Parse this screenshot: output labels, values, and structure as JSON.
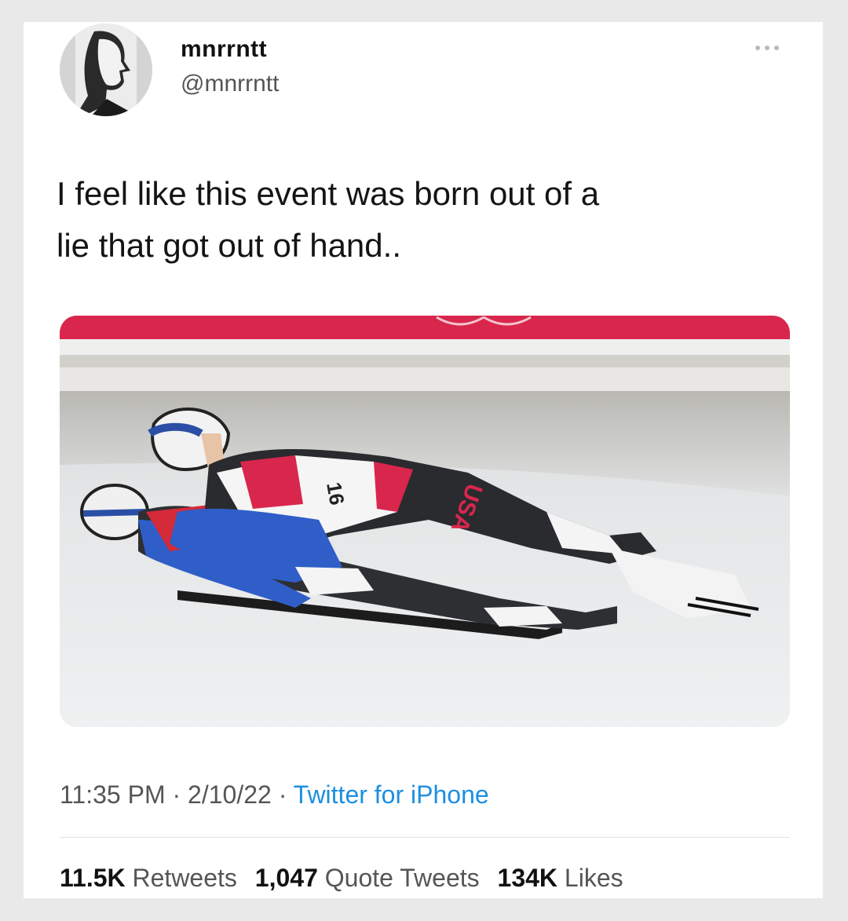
{
  "user": {
    "display_name": "mnrrntt",
    "handle": "@mnrrntt"
  },
  "tweet": {
    "text_line1": "I feel like this event was born out of a",
    "text_line2": "lie that got out of hand.."
  },
  "media": {
    "bib_number": "16",
    "suit_text": "USA"
  },
  "meta": {
    "time": "11:35 PM",
    "separator": "·",
    "date": "2/10/22",
    "source": "Twitter for iPhone"
  },
  "stats": {
    "retweets_count": "11.5K",
    "retweets_label": "Retweets",
    "quotes_count": "1,047",
    "quotes_label": "Quote Tweets",
    "likes_count": "134K",
    "likes_label": "Likes"
  },
  "colors": {
    "link": "#1d8fe0",
    "olympic_red": "#d9264d"
  }
}
